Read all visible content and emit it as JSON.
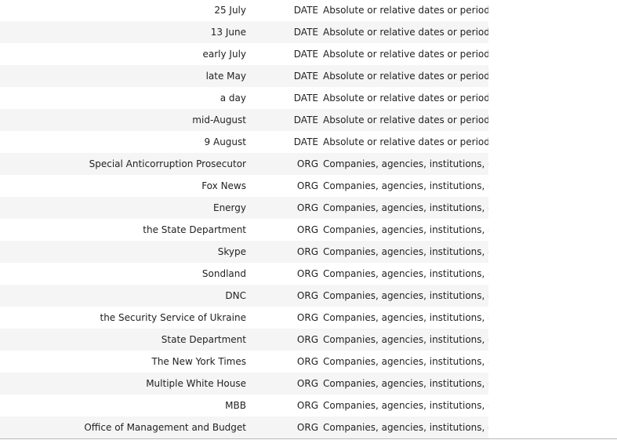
{
  "entities": [
    {
      "text": "25 July",
      "label": "DATE",
      "description": "Absolute or relative dates or periods"
    },
    {
      "text": "13 June",
      "label": "DATE",
      "description": "Absolute or relative dates or periods"
    },
    {
      "text": "early July",
      "label": "DATE",
      "description": "Absolute or relative dates or periods"
    },
    {
      "text": "late May",
      "label": "DATE",
      "description": "Absolute or relative dates or periods"
    },
    {
      "text": "a day",
      "label": "DATE",
      "description": "Absolute or relative dates or periods"
    },
    {
      "text": "mid-August",
      "label": "DATE",
      "description": "Absolute or relative dates or periods"
    },
    {
      "text": "9 August",
      "label": "DATE",
      "description": "Absolute or relative dates or periods"
    },
    {
      "text": "Special Anticorruption Prosecutor",
      "label": "ORG",
      "description": "Companies, agencies, institutions, etc."
    },
    {
      "text": "Fox News",
      "label": "ORG",
      "description": "Companies, agencies, institutions, etc."
    },
    {
      "text": "Energy",
      "label": "ORG",
      "description": "Companies, agencies, institutions, etc."
    },
    {
      "text": "the State Department",
      "label": "ORG",
      "description": "Companies, agencies, institutions, etc."
    },
    {
      "text": "Skype",
      "label": "ORG",
      "description": "Companies, agencies, institutions, etc."
    },
    {
      "text": "Sondland",
      "label": "ORG",
      "description": "Companies, agencies, institutions, etc."
    },
    {
      "text": "DNC",
      "label": "ORG",
      "description": "Companies, agencies, institutions, etc."
    },
    {
      "text": "the Security Service of Ukraine",
      "label": "ORG",
      "description": "Companies, agencies, institutions, etc."
    },
    {
      "text": "State Department",
      "label": "ORG",
      "description": "Companies, agencies, institutions, etc."
    },
    {
      "text": "The New York Times",
      "label": "ORG",
      "description": "Companies, agencies, institutions, etc."
    },
    {
      "text": "Multiple White House",
      "label": "ORG",
      "description": "Companies, agencies, institutions, etc."
    },
    {
      "text": "MBB",
      "label": "ORG",
      "description": "Companies, agencies, institutions, etc."
    },
    {
      "text": "Office of Management and Budget",
      "label": "ORG",
      "description": "Companies, agencies, institutions, etc."
    }
  ]
}
